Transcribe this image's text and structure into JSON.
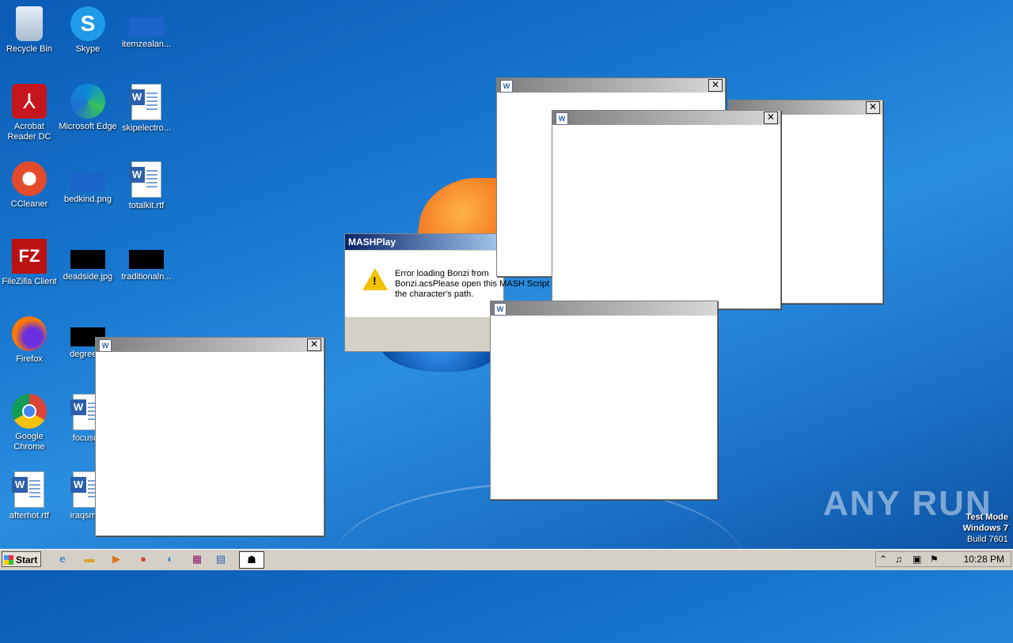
{
  "desktop": {
    "icons": [
      {
        "label": "Recycle Bin",
        "icon": "recycle-bin-icon"
      },
      {
        "label": "Skype",
        "icon": "skype-icon",
        "glyph": "S"
      },
      {
        "label": "itemzealan...",
        "icon": "image-file-icon"
      },
      {
        "label": "Acrobat Reader DC",
        "icon": "acrobat-icon",
        "glyph": "⅄"
      },
      {
        "label": "Microsoft Edge",
        "icon": "edge-icon"
      },
      {
        "label": "skipelectro...",
        "icon": "word-doc-icon"
      },
      {
        "label": "CCleaner",
        "icon": "ccleaner-icon"
      },
      {
        "label": "bedkind.png",
        "icon": "image-file-icon"
      },
      {
        "label": "totalkit.rtf",
        "icon": "word-doc-icon"
      },
      {
        "label": "FileZilla Client",
        "icon": "filezilla-icon",
        "glyph": "FZ"
      },
      {
        "label": "deadside.jpg",
        "icon": "image-file-icon"
      },
      {
        "label": "traditionaln...",
        "icon": "image-file-icon"
      },
      {
        "label": "Firefox",
        "icon": "firefox-icon"
      },
      {
        "label": "degreeco",
        "icon": "image-file-icon"
      },
      {
        "label": "Google Chrome",
        "icon": "chrome-icon"
      },
      {
        "label": "focusun",
        "icon": "word-doc-icon"
      },
      {
        "label": "afterhot.rtf",
        "icon": "word-doc-icon"
      },
      {
        "label": "iraqsmith",
        "icon": "word-doc-icon"
      }
    ]
  },
  "dialog": {
    "title": "MASHPlay",
    "message": "Error loading Bonzi from\nBonzi.acsPlease open this MASH Script in\nthe character's path.",
    "warning_glyph": "!"
  },
  "window_glyphs": {
    "close": "✕",
    "app": "W"
  },
  "taskbar": {
    "start_label": "Start",
    "time": "10:28 PM",
    "buttons": [
      "ie-icon",
      "explorer-icon",
      "media-player-icon",
      "chrome-icon",
      "edge-icon",
      "winrar-icon",
      "word-icon",
      "mashplay-icon"
    ]
  },
  "watermark": "ANY RUN",
  "test_mode": {
    "line1": "Test Mode",
    "line2": "Windows 7",
    "line3": "Build 7601"
  }
}
